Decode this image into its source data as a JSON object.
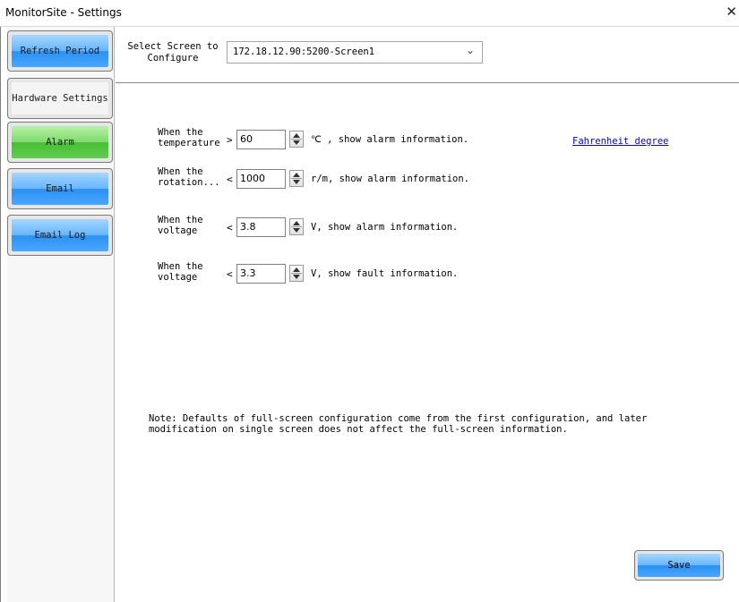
{
  "window": {
    "title": "MonitorSite - Settings",
    "close_glyph": "✕"
  },
  "sidebar": {
    "items": [
      {
        "label": "Refresh Period",
        "state": "normal"
      },
      {
        "label": "Hardware Settings",
        "state": "inactive"
      },
      {
        "label": "Alarm",
        "state": "selected"
      },
      {
        "label": "Email",
        "state": "normal"
      },
      {
        "label": "Email Log",
        "state": "normal"
      }
    ]
  },
  "screen_select": {
    "label_line1": "Select Screen to",
    "label_line2": "Configure",
    "value": "172.18.12.90:5200-Screen1"
  },
  "alarms": [
    {
      "cond_line1": "When the",
      "cond_line2": "temperature",
      "operator": ">",
      "value": "60",
      "unit_text": "℃ , show alarm information."
    },
    {
      "cond_line1": "When the",
      "cond_line2": "rotation...",
      "operator": "<",
      "value": "1000",
      "unit_text": "r/m, show alarm information."
    },
    {
      "cond_line1": "When the",
      "cond_line2": "voltage",
      "operator": "<",
      "value": "3.8",
      "unit_text": "V, show alarm information."
    },
    {
      "cond_line1": "When the",
      "cond_line2": "voltage",
      "operator": "<",
      "value": "3.3",
      "unit_text": "V, show fault information."
    }
  ],
  "fahrenheit_link": "Fahrenheit degree",
  "note": {
    "line1": "Note: Defaults of full-screen configuration come from the first configuration, and later",
    "line2": "modification on single screen does not affect the full-screen information."
  },
  "save_label": "Save",
  "colors": {
    "button_blue": "#4aa7ff",
    "button_green": "#62cc50",
    "link": "#0000ee"
  }
}
